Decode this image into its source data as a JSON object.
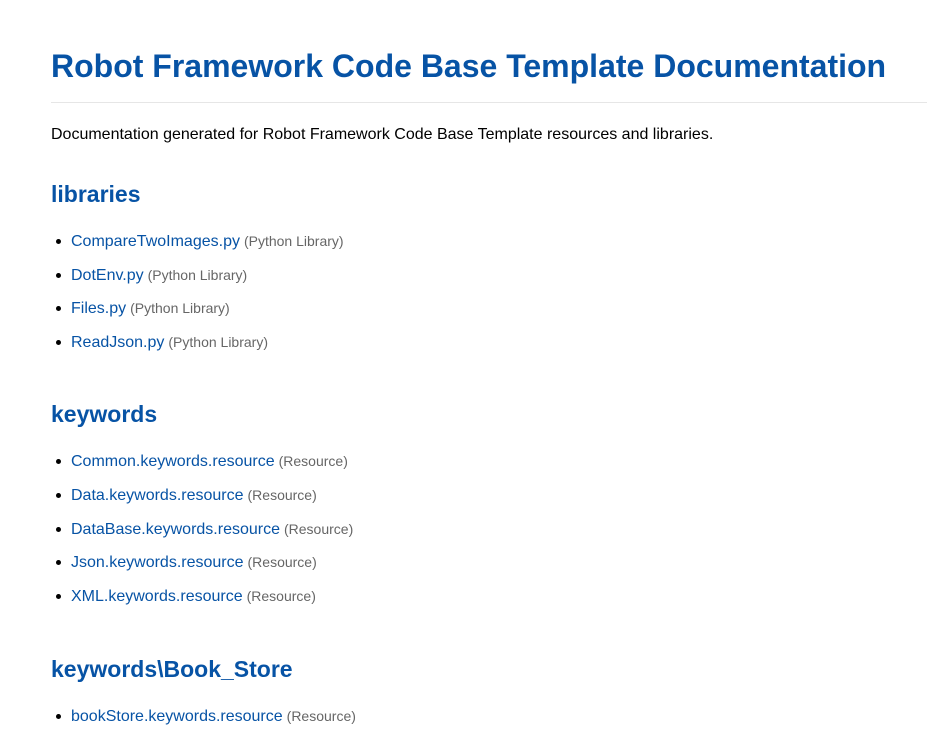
{
  "page": {
    "title": "Robot Framework Code Base Template Documentation",
    "intro": "Documentation generated for Robot Framework Code Base Template resources and libraries."
  },
  "sections": [
    {
      "heading": "libraries",
      "items": [
        {
          "link": "CompareTwoImages.py",
          "type": "(Python Library)"
        },
        {
          "link": "DotEnv.py",
          "type": "(Python Library)"
        },
        {
          "link": "Files.py",
          "type": "(Python Library)"
        },
        {
          "link": "ReadJson.py",
          "type": "(Python Library)"
        }
      ]
    },
    {
      "heading": "keywords",
      "items": [
        {
          "link": "Common.keywords.resource",
          "type": "(Resource)"
        },
        {
          "link": "Data.keywords.resource",
          "type": "(Resource)"
        },
        {
          "link": "DataBase.keywords.resource",
          "type": "(Resource)"
        },
        {
          "link": "Json.keywords.resource",
          "type": "(Resource)"
        },
        {
          "link": "XML.keywords.resource",
          "type": "(Resource)"
        }
      ]
    },
    {
      "heading": "keywords\\Book_Store",
      "items": [
        {
          "link": "bookStore.keywords.resource",
          "type": "(Resource)"
        }
      ]
    }
  ],
  "colors": {
    "heading": "#0753a5",
    "link": "#0753a5",
    "type_text": "#666666",
    "rule": "#e6e6e6"
  }
}
